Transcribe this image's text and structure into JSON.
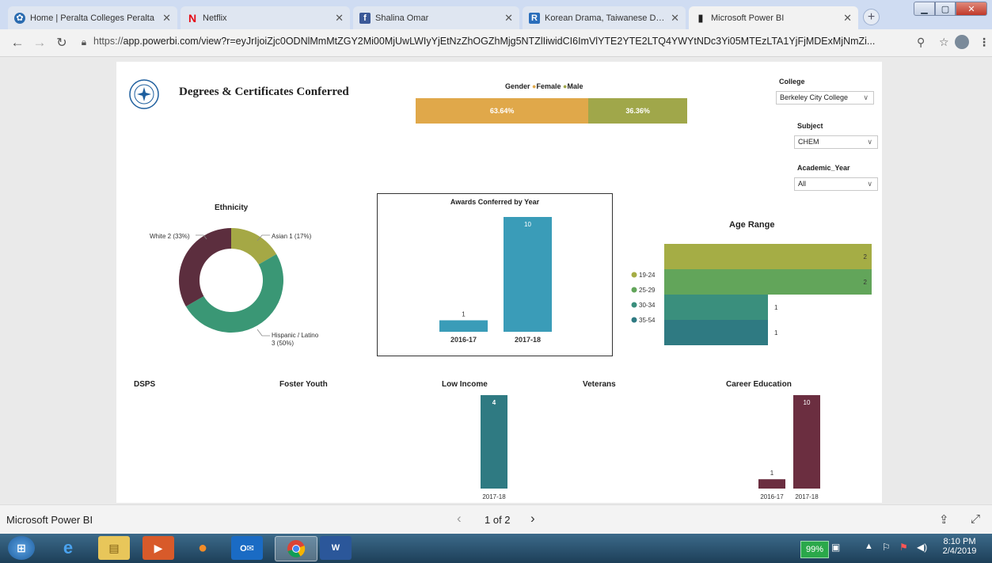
{
  "browser": {
    "tabs": [
      {
        "title": "Home | Peralta Colleges Peralta",
        "icon": "peralta-logo-icon"
      },
      {
        "title": "Netflix",
        "icon": "netflix-icon"
      },
      {
        "title": "Shalina Omar",
        "icon": "facebook-icon"
      },
      {
        "title": "Korean Drama, Taiwanese Dram",
        "icon": "rakuten-icon"
      },
      {
        "title": "Microsoft Power BI",
        "icon": "powerbi-icon"
      }
    ],
    "url_scheme": "https://",
    "url_rest": "app.powerbi.com/view?r=eyJrIjoiZjc0ODNlMmMtZGY2Mi00MjUwLWIyYjEtNzZhOGZhMjg5NTZlIiwidCI6ImVlYTE2YTE2LTQ4YWYtNDc3Yi05MTEzLTA1YjFjMDExMjNmZi..."
  },
  "report": {
    "title": "Degrees & Certificates Conferred",
    "gender": {
      "label": "Gender",
      "legend": [
        "Female",
        "Male"
      ],
      "female_pct": "63.64%",
      "male_pct": "36.36%",
      "female_share": 0.6364
    },
    "slicers": {
      "college_label": "College",
      "college_value": "Berkeley City College",
      "subject_label": "Subject",
      "subject_value": "CHEM",
      "year_label": "Academic_Year",
      "year_value": "All"
    },
    "ethnicity": {
      "title": "Ethnicity",
      "labels": [
        "White 2 (33%)",
        "Asian 1 (17%)",
        "Hispanic / Latino",
        "3 (50%)"
      ]
    },
    "awards": {
      "title": "Awards Conferred by Year"
    },
    "age": {
      "title": "Age Range"
    },
    "sections": {
      "dsps": "DSPS",
      "foster": "Foster Youth",
      "low_income": "Low Income",
      "veterans": "Veterans",
      "career": "Career Education"
    }
  },
  "chart_data": [
    {
      "type": "pie",
      "title": "Ethnicity",
      "categories": [
        "White",
        "Asian",
        "Hispanic / Latino"
      ],
      "values": [
        2,
        1,
        3
      ],
      "percents": [
        33,
        17,
        50
      ],
      "colors": [
        "#5c2e3e",
        "#a5a845",
        "#3a9775"
      ]
    },
    {
      "type": "bar",
      "title": "Awards Conferred by Year",
      "categories": [
        "2016-17",
        "2017-18"
      ],
      "values": [
        1,
        10
      ],
      "color": "#3a9cb8"
    },
    {
      "type": "bar",
      "title": "Age Range",
      "orientation": "horizontal",
      "categories": [
        "19-24",
        "25-29",
        "30-34",
        "35-54"
      ],
      "values": [
        2,
        2,
        1,
        1
      ],
      "colors": [
        "#a5ad45",
        "#62a55a",
        "#3a8f7d",
        "#2f7a82"
      ]
    },
    {
      "type": "bar",
      "title": "Low Income",
      "categories": [
        "2017-18"
      ],
      "values": [
        4
      ],
      "color": "#2f7a82"
    },
    {
      "type": "bar",
      "title": "Career Education",
      "categories": [
        "2016-17",
        "2017-18"
      ],
      "values": [
        1,
        10
      ],
      "color": "#6b2e40"
    }
  ],
  "footer": {
    "brand": "Microsoft Power BI",
    "pager": "1 of 2"
  },
  "taskbar": {
    "battery": "99%",
    "time": "8:10 PM",
    "date": "2/4/2019"
  },
  "colors": {
    "female": "#e0a84a",
    "male": "#a0a74a"
  }
}
